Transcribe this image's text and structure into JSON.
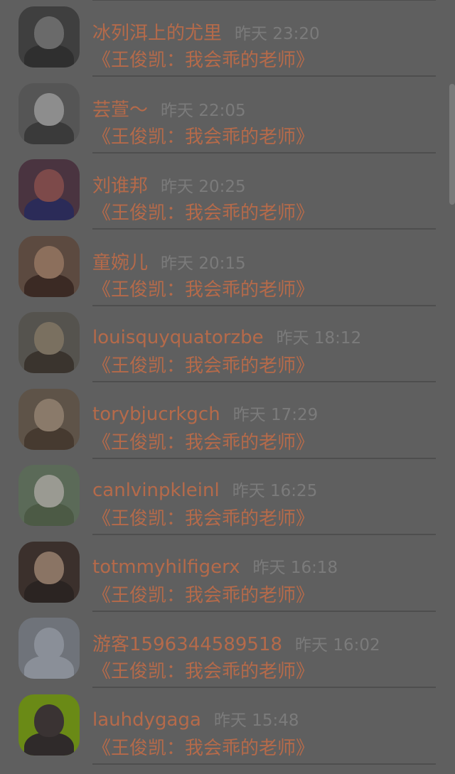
{
  "items": [
    {
      "name": "冰列洱上的尤里",
      "time": "昨天 23:20",
      "title": "《王俊凯：我会乖的老师》",
      "avatar_colors": [
        "#3f3f3f",
        "#2f2f2f",
        "#6a6a6a"
      ]
    },
    {
      "name": "芸萱～",
      "time": "昨天 22:05",
      "title": "《王俊凯：我会乖的老师》",
      "avatar_colors": [
        "#555555",
        "#3a3a3a",
        "#8d8d8d"
      ]
    },
    {
      "name": "刘谁邦",
      "time": "昨天 20:25",
      "title": "《王俊凯：我会乖的老师》",
      "avatar_colors": [
        "#4a3440",
        "#2b2b58",
        "#7d4a4a"
      ]
    },
    {
      "name": "童婉儿",
      "time": "昨天 20:15",
      "title": "《王俊凯：我会乖的老师》",
      "avatar_colors": [
        "#5c4a40",
        "#3b2a24",
        "#8c6f5c"
      ]
    },
    {
      "name": "louisquyquatorzbe",
      "time": "昨天 18:12",
      "title": "《王俊凯：我会乖的老师》",
      "avatar_colors": [
        "#55534e",
        "#3a342e",
        "#7a7060"
      ]
    },
    {
      "name": "torybjucrkgch",
      "time": "昨天 17:29",
      "title": "《王俊凯：我会乖的老师》",
      "avatar_colors": [
        "#5e5348",
        "#463a30",
        "#8a7a6a"
      ]
    },
    {
      "name": "canlvinpkleinl",
      "time": "昨天 16:25",
      "title": "《王俊凯：我会乖的老师》",
      "avatar_colors": [
        "#5b6a58",
        "#4c5a45",
        "#9a9a92"
      ]
    },
    {
      "name": "totmmyhilfigerx",
      "time": "昨天 16:18",
      "title": "《王俊凯：我会乖的老师》",
      "avatar_colors": [
        "#3b302c",
        "#2b2422",
        "#8a7464"
      ]
    },
    {
      "name": "游客1596344589518",
      "time": "昨天 16:02",
      "title": "《王俊凯：我会乖的老师》",
      "avatar_colors": [
        "#6f737a",
        "#8a8f98",
        "#8a8f98"
      ]
    },
    {
      "name": "lauhdygaga",
      "time": "昨天 15:48",
      "title": "《王俊凯：我会乖的老师》",
      "avatar_colors": [
        "#6a8a16",
        "#2f2a2a",
        "#3a3333"
      ]
    }
  ]
}
